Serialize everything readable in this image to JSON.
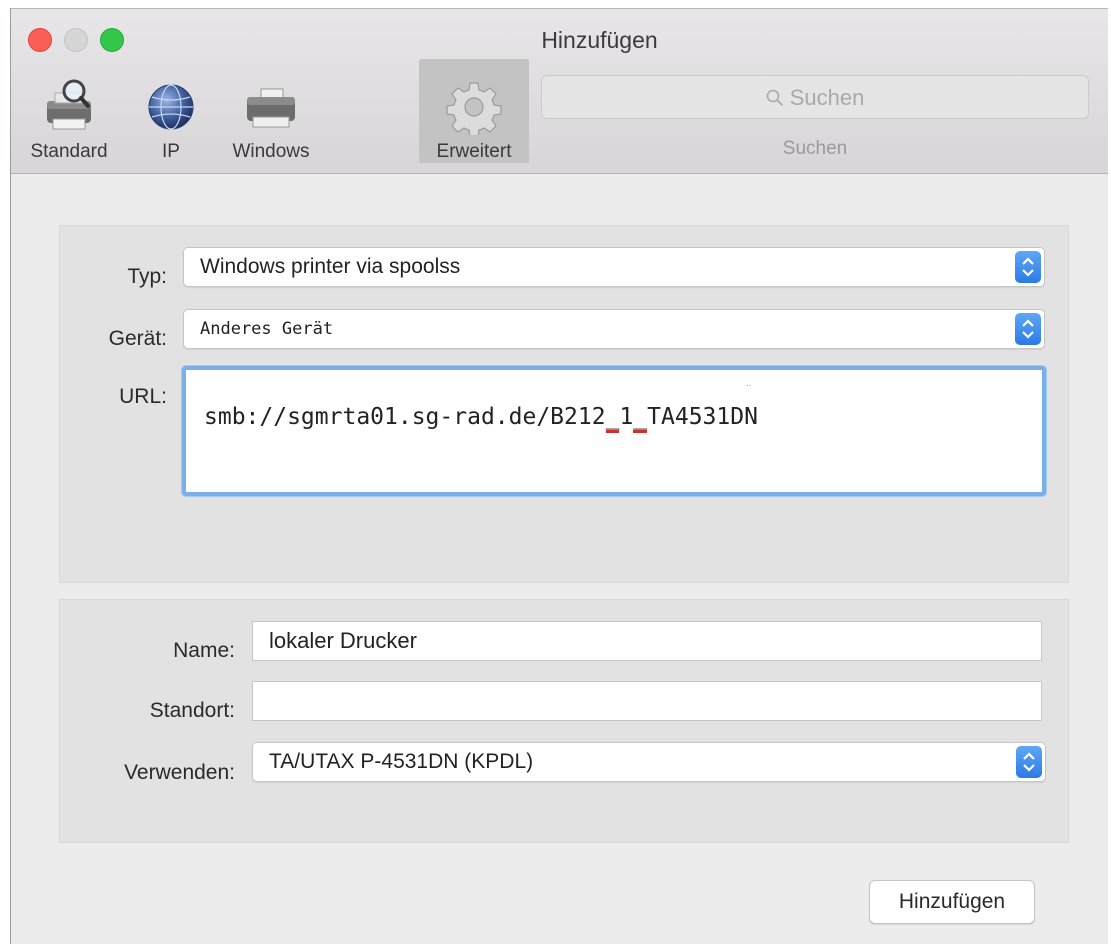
{
  "window": {
    "title": "Hinzufügen"
  },
  "toolbar": {
    "items": [
      {
        "label": "Standard",
        "icon": "printer-magnifier-icon"
      },
      {
        "label": "IP",
        "icon": "globe-icon"
      },
      {
        "label": "Windows",
        "icon": "printer-icon"
      },
      {
        "label": "Erweitert",
        "icon": "gear-icon",
        "selected": true
      }
    ],
    "search_placeholder": "Suchen",
    "search_label": "Suchen"
  },
  "form": {
    "type_label": "Typ:",
    "type_value": "Windows printer via spoolss",
    "device_label": "Gerät:",
    "device_value": "Anderes Gerät",
    "url_label": "URL:",
    "url_part1": "smb://sgmrta01.sg-rad.de/B212",
    "url_part2": "_",
    "url_part3": "1",
    "url_part4": "_",
    "url_part5": "TA4531DN",
    "url_dots": "..",
    "name_label": "Name:",
    "name_value": "lokaler Drucker",
    "location_label": "Standort:",
    "location_value": "",
    "use_label": "Verwenden:",
    "use_value": "TA/UTAX P-4531DN (KPDL)"
  },
  "actions": {
    "add_label": "Hinzufügen"
  },
  "colors": {
    "close": "#fc5f57",
    "minimize": "#d6d6d6",
    "maximize": "#34c84a",
    "accent": "#2b7ae6",
    "focus_ring": "#7ab0ea"
  }
}
